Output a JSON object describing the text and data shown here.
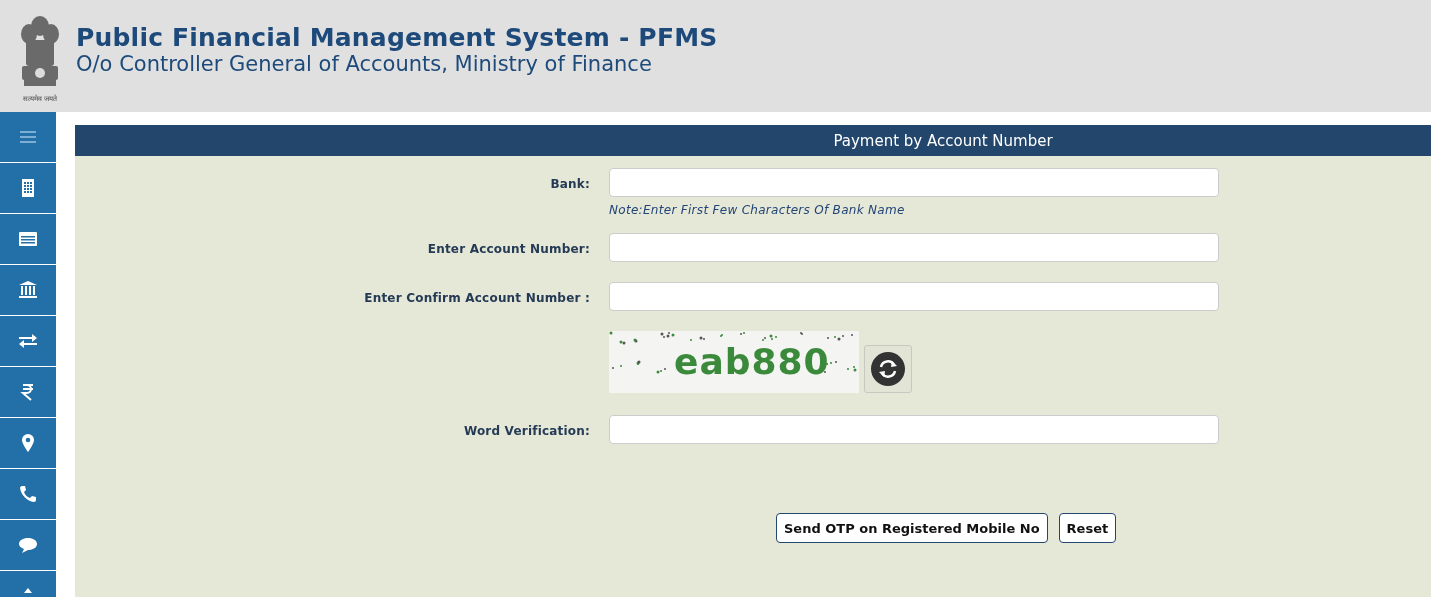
{
  "header": {
    "title": "Public Financial Management System - PFMS",
    "subtitle": "O/o Controller General of Accounts, Ministry of Finance",
    "motto": "सत्यमेव जयते"
  },
  "sidebar": {
    "items": [
      {
        "kind": "menu"
      },
      {
        "kind": "building"
      },
      {
        "kind": "list"
      },
      {
        "kind": "bank"
      },
      {
        "kind": "transfer"
      },
      {
        "kind": "rupee"
      },
      {
        "kind": "pin"
      },
      {
        "kind": "phone"
      },
      {
        "kind": "chat"
      },
      {
        "kind": "up"
      }
    ]
  },
  "form": {
    "title": "Payment by Account Number",
    "fields": [
      {
        "kind": "input",
        "label": "Bank:",
        "note": "Note:Enter First Few Characters Of Bank Name"
      },
      {
        "kind": "input",
        "label": "Enter Account Number:"
      },
      {
        "kind": "input",
        "label": "Enter Confirm Account Number :"
      },
      {
        "kind": "captcha",
        "captcha": "eab880"
      },
      {
        "kind": "input",
        "label": "Word Verification:"
      }
    ],
    "buttons": [
      "Send OTP on Registered Mobile No",
      "Reset"
    ]
  }
}
